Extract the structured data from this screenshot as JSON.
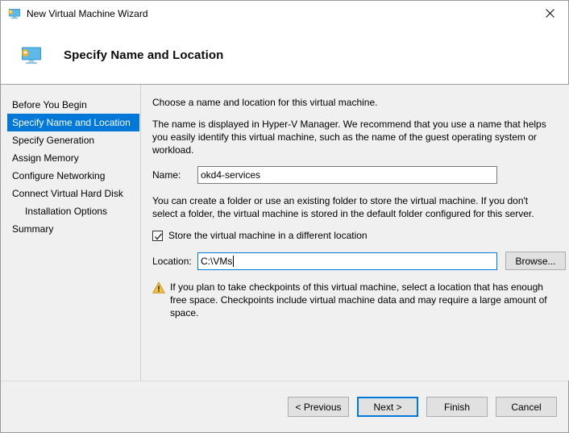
{
  "window": {
    "title": "New Virtual Machine Wizard",
    "icon": "virtual-machine-icon",
    "close_label": "×"
  },
  "header": {
    "title": "Specify Name and Location",
    "icon": "virtual-machine-icon"
  },
  "sidebar": {
    "items": [
      {
        "label": "Before You Begin",
        "selected": false,
        "indent": false
      },
      {
        "label": "Specify Name and Location",
        "selected": true,
        "indent": false
      },
      {
        "label": "Specify Generation",
        "selected": false,
        "indent": false
      },
      {
        "label": "Assign Memory",
        "selected": false,
        "indent": false
      },
      {
        "label": "Configure Networking",
        "selected": false,
        "indent": false
      },
      {
        "label": "Connect Virtual Hard Disk",
        "selected": false,
        "indent": false
      },
      {
        "label": "Installation Options",
        "selected": false,
        "indent": true
      },
      {
        "label": "Summary",
        "selected": false,
        "indent": false
      }
    ]
  },
  "main": {
    "intro": "Choose a name and location for this virtual machine.",
    "description": "The name is displayed in Hyper-V Manager. We recommend that you use a name that helps you easily identify this virtual machine, such as the name of the guest operating system or workload.",
    "name_label": "Name:",
    "name_value": "okd4-services",
    "name_placeholder": "",
    "folder_description": "You can create a folder or use an existing folder to store the virtual machine. If you don't select a folder, the virtual machine is stored in the default folder configured for this server.",
    "checkbox_label": "Store the virtual machine in a different location",
    "checkbox_checked": true,
    "location_label": "Location:",
    "location_value": "C:\\VMs",
    "location_placeholder": "",
    "browse_label": "Browse...",
    "warning_text": "If you plan to take checkpoints of this virtual machine, select a location that has enough free space. Checkpoints include virtual machine data and may require a large amount of space."
  },
  "footer": {
    "previous_label": "< Previous",
    "next_label": "Next >",
    "finish_label": "Finish",
    "cancel_label": "Cancel"
  },
  "colors": {
    "accent": "#0078d7",
    "window_bg": "#f0f0f0",
    "header_bg": "#ffffff",
    "warning": "#e8a317"
  }
}
